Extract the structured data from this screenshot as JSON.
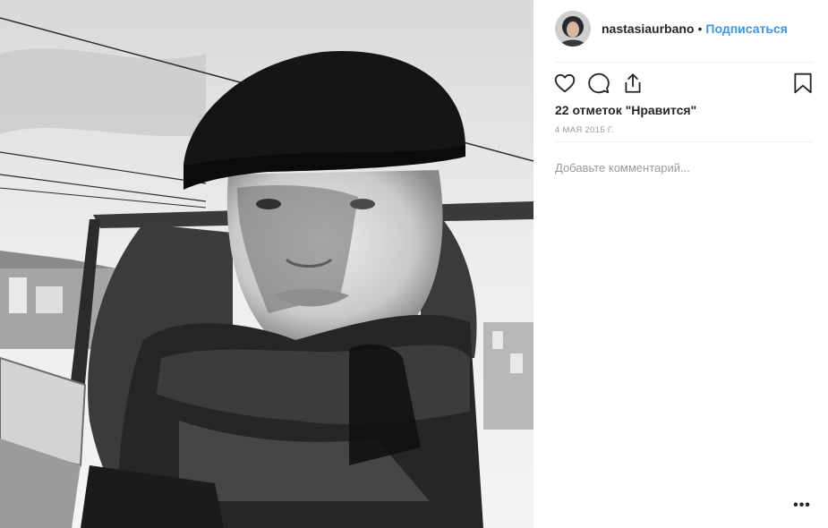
{
  "post": {
    "username": "nastasiaurbano",
    "separator": "•",
    "follow_label": "Подписаться",
    "likes_text": "22 отметок \"Нравится\"",
    "date_text": "4 МАЯ 2015 Г.",
    "comment_placeholder": "Добавьте комментарий...",
    "more_label": "•••"
  },
  "icons": {
    "like": "heart-icon",
    "comment": "speech-bubble-icon",
    "share": "share-icon",
    "save": "bookmark-icon"
  },
  "colors": {
    "follow": "#3897f0",
    "text": "#262626",
    "muted": "#999999",
    "divider": "#efefef"
  }
}
